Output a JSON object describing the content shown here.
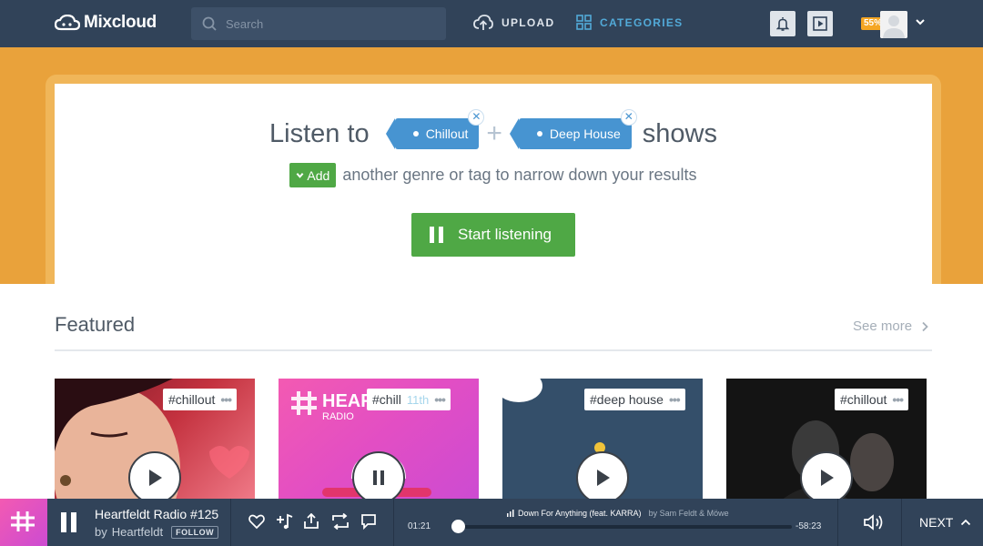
{
  "header": {
    "logo_text": "Mixcloud",
    "search_placeholder": "Search",
    "upload_label": "UPLOAD",
    "categories_label": "CATEGORIES",
    "profile_completion": "55%"
  },
  "hero": {
    "listen_to": "Listen to",
    "tags": [
      {
        "label": "Chillout"
      },
      {
        "label": "Deep House"
      }
    ],
    "shows": "shows",
    "add_label": "Add",
    "sub_text": "another genre or tag to narrow down your results",
    "start_label": "Start listening"
  },
  "featured": {
    "title": "Featured",
    "see_more": "See more",
    "cards": [
      {
        "tag": "#chillout",
        "date": ""
      },
      {
        "tag": "#chill",
        "date": "11th"
      },
      {
        "tag": "#deep house",
        "date": ""
      },
      {
        "tag": "#chillout",
        "date": ""
      }
    ]
  },
  "player": {
    "title": "Heartfeldt Radio #125",
    "by_prefix": "by",
    "artist": "Heartfeldt",
    "follow_label": "FOLLOW",
    "elapsed": "01:21",
    "remaining": "-58:23",
    "now_track": "Down For Anything (feat. KARRA)",
    "now_by": "by Sam Feldt & Möwe",
    "progress": 0.005,
    "next_label": "NEXT"
  },
  "colors": {
    "header_bg": "#314359",
    "hero_bg": "#e9a23b",
    "tag_blue": "#4794d1",
    "green": "#4fa845",
    "accent_link": "#52aad8"
  }
}
